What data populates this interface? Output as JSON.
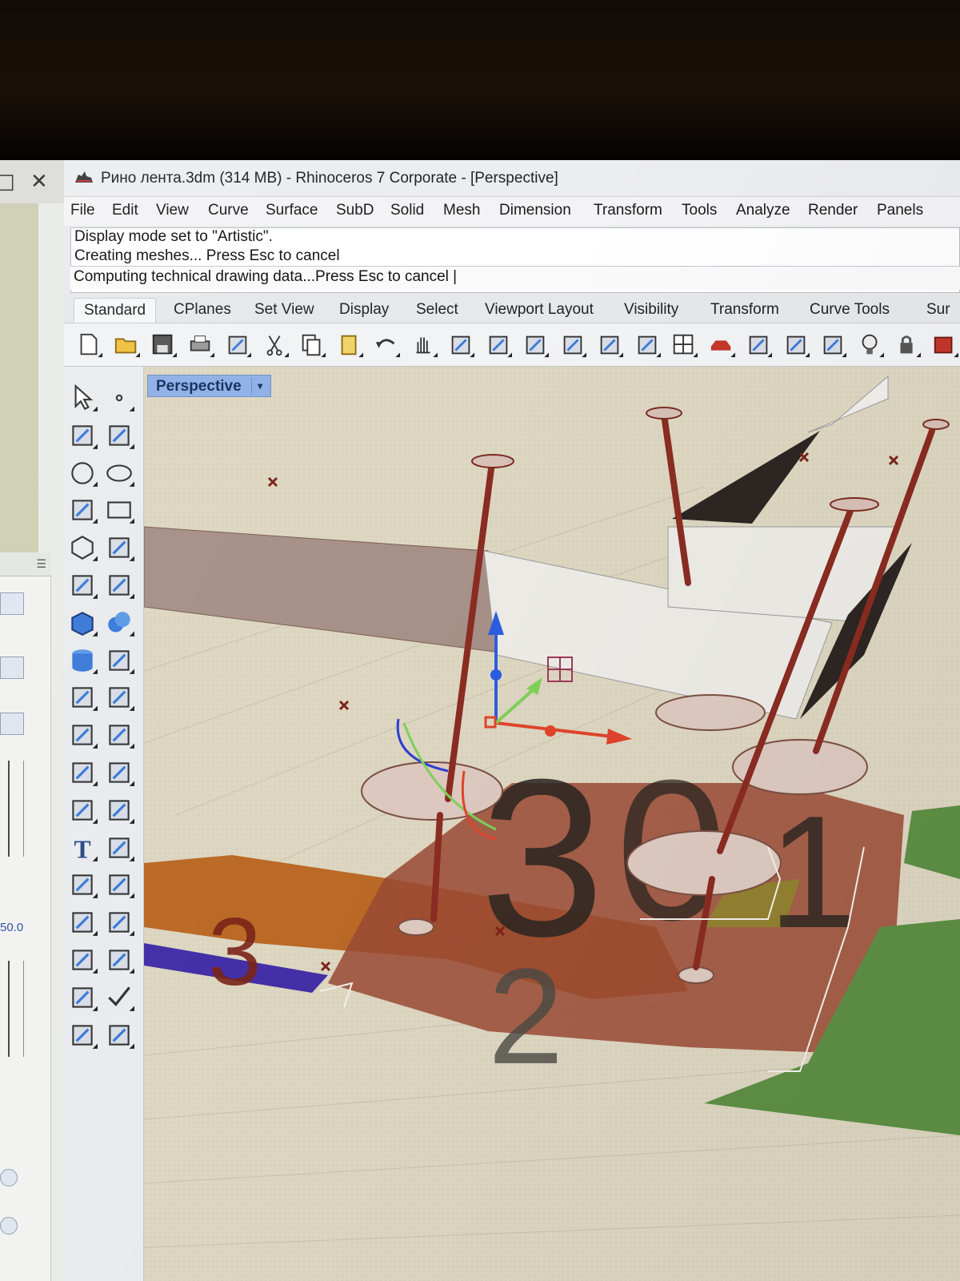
{
  "window": {
    "title": "Рино лента.3dm (314 MB) - Rhinoceros 7 Corporate - [Perspective]"
  },
  "left_window": {
    "restore_glyph": "□",
    "close_glyph": "✕",
    "pane_value": "50.0"
  },
  "menu": {
    "items": [
      "File",
      "Edit",
      "View",
      "Curve",
      "Surface",
      "SubD",
      "Solid",
      "Mesh",
      "Dimension",
      "Transform",
      "Tools",
      "Analyze",
      "Render",
      "Panels"
    ]
  },
  "command": {
    "history": [
      "Display mode set to \"Artistic\".",
      "Creating meshes... Press Esc to cancel"
    ],
    "prompt": "Computing technical drawing data...Press Esc to cancel |"
  },
  "toolbar_tabs": [
    "Standard",
    "CPlanes",
    "Set View",
    "Display",
    "Select",
    "Viewport Layout",
    "Visibility",
    "Transform",
    "Curve Tools",
    "Sur"
  ],
  "toolbar_icons": [
    "new-file-icon",
    "open-folder-icon",
    "save-icon",
    "print-icon",
    "import-icon",
    "cut-icon",
    "copy-icon",
    "paste-icon",
    "undo-icon",
    "pan-hand-icon",
    "rotate-view-icon",
    "zoom-dynamic-icon",
    "zoom-window-icon",
    "zoom-extents-icon",
    "zoom-selected-icon",
    "rotate-camera-icon",
    "four-viewports-icon",
    "car-named-view-icon",
    "grid-cplane-icon",
    "object-snap-icon",
    "set-points-icon",
    "render-light-icon",
    "lock-icon",
    "materials-icon"
  ],
  "sidebar_icons": [
    "select-arrow-icon",
    "point-icon",
    "polyline-icon",
    "curve-icon",
    "circle-icon",
    "ellipse-icon",
    "arc-icon",
    "rectangle-icon",
    "polygon-icon",
    "fillet-curve-icon",
    "surface-corner-icon",
    "extrude-surface-icon",
    "box-solid-icon",
    "sphere-solid-icon",
    "cylinder-solid-icon",
    "mesh-plane-icon",
    "boolean-union-icon",
    "explode-icon",
    "trim-icon",
    "split-icon",
    "group-icon",
    "ungroup-icon",
    "offset-curve-icon",
    "blend-curve-icon",
    "text-icon",
    "scale-icon",
    "array-icon",
    "mirror-icon",
    "box-edit-icon",
    "bring-to-cplane-icon",
    "grid-array-icon",
    "pipe-icon",
    "gumball-icon",
    "check-icon",
    "cube-render-icon",
    "ruler-icon"
  ],
  "viewport": {
    "label": "Perspective",
    "dropdown_glyph": "▾",
    "numbers": [
      "3",
      "0",
      "1",
      "3",
      "2"
    ]
  },
  "colors": {
    "viewport_bg": "#ddd6c1",
    "accent": "#8fb0e6",
    "terrain_brown": "#9a4a34",
    "terrain_orange": "#b8631e",
    "pole_red": "#8a2c22",
    "green": "#5e8f45"
  }
}
